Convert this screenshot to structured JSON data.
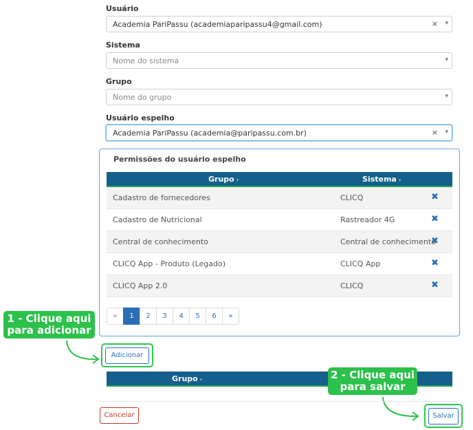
{
  "form": {
    "usuario": {
      "label": "Usuário",
      "value": "Academia PariPassu (academiaparipassu4@gmail.com)"
    },
    "sistema": {
      "label": "Sistema",
      "placeholder": "Nome do sistema"
    },
    "grupo": {
      "label": "Grupo",
      "placeholder": "Nome do grupo"
    },
    "usuario_espelho": {
      "label": "Usuário espelho",
      "value": "Academia PariPassu (academia@paripassu.com.br)"
    },
    "clear_glyph": "×",
    "arrow_glyph": "▾"
  },
  "permissions": {
    "title": "Permissões do usuário espelho",
    "columns": {
      "grupo": "Grupo",
      "sistema": "Sistema"
    },
    "sort_glyph": "▾",
    "delete_glyph": "✖",
    "rows": [
      {
        "grupo": "Cadastro de fornecedores",
        "sistema": "CLICQ"
      },
      {
        "grupo": "Cadastro de Nutricional",
        "sistema": "Rastreador 4G"
      },
      {
        "grupo": "Central de conhecimento",
        "sistema": "Central de conhecimento"
      },
      {
        "grupo": "CLICQ App - Produto (Legado)",
        "sistema": "CLICQ App"
      },
      {
        "grupo": "CLICQ App 2.0",
        "sistema": "CLICQ"
      }
    ],
    "pagination": {
      "prev": "«",
      "pages": [
        "1",
        "2",
        "3",
        "4",
        "5",
        "6"
      ],
      "next": "»",
      "active": "1"
    }
  },
  "buttons": {
    "adicionar": "Adicionar",
    "cancelar": "Cancelar",
    "salvar": "Salvar"
  },
  "added_table": {
    "column_grupo": "Grupo"
  },
  "annotations": {
    "step1_line1": "1 - Clique aqui",
    "step1_line2": "para adicionar",
    "step2_line1": "2 - Clique aqui",
    "step2_line2": "para salvar"
  },
  "colors": {
    "header": "#145f8c",
    "accent_green": "#2cc14b",
    "link_blue": "#2a6fb5",
    "cancel_red": "#c0392b"
  }
}
